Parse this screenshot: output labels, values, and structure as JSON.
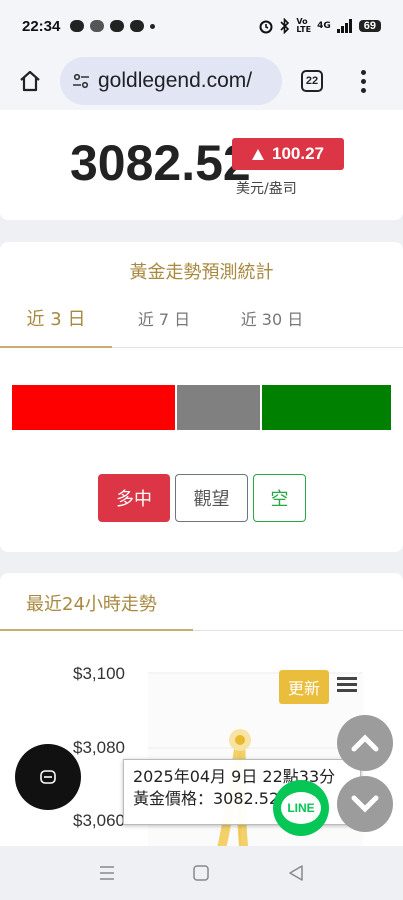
{
  "status_bar": {
    "time": "22:34",
    "network": "4G",
    "battery": "69"
  },
  "browser": {
    "url": "goldlegend.com/",
    "tab_count": "22"
  },
  "price_card": {
    "price": "3082.52",
    "change": "100.27",
    "unit": "美元/盎司"
  },
  "forecast": {
    "title": "黃金走勢預測統計",
    "tabs": [
      {
        "label": "近 3 日",
        "active": true
      },
      {
        "label": "近 7 日",
        "active": false
      },
      {
        "label": "近 30 日",
        "active": false
      }
    ],
    "distribution": [
      {
        "name": "up",
        "fraction": 0.43,
        "color": "#ff0000"
      },
      {
        "name": "flat",
        "fraction": 0.225,
        "color": "#808080"
      },
      {
        "name": "down",
        "fraction": 0.345,
        "color": "#008000"
      }
    ],
    "buttons": {
      "up": "多中",
      "flat": "觀望",
      "down": "空"
    }
  },
  "trend": {
    "title": "最近24小時走勢",
    "refresh_label": "更新",
    "y_ticks": [
      "$3,100",
      "$3,080",
      "$3,060"
    ],
    "tooltip": {
      "line1": "2025年04月 9日 22點33分",
      "line2": "黃金價格：3082.52 美元"
    }
  },
  "line_label": "LINE",
  "colors": {
    "accent_gold": "#a8893f",
    "badge_red": "#dc3545",
    "refresh_yellow": "#ebbd3c",
    "line_green": "#06c755"
  }
}
